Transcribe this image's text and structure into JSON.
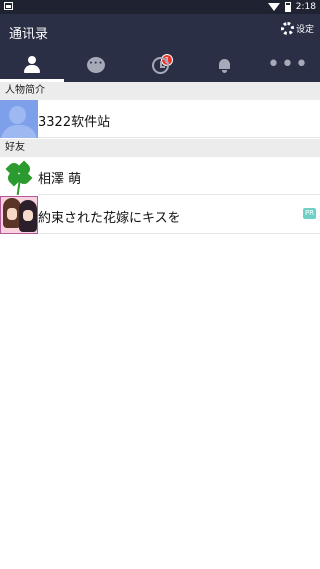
{
  "status_bar": {
    "time": "2:18"
  },
  "app_bar": {
    "title": "通讯录",
    "settings_label": "设定"
  },
  "tabs": [
    {
      "icon": "person-icon",
      "active": true
    },
    {
      "icon": "chat-icon",
      "badge": "1"
    },
    {
      "icon": "clock-icon"
    },
    {
      "icon": "bell-icon"
    },
    {
      "icon": "more-icon",
      "glyph": "•••"
    }
  ],
  "profile": {
    "section_title": "人物简介",
    "name": "3322软件站"
  },
  "friends": {
    "section_title": "好友",
    "items": [
      {
        "name": "相澤 萌",
        "avatar": "clover-avatar"
      },
      {
        "name": "約束された花嫁にキスを",
        "avatar": "anime-avatar",
        "tag": "PR"
      }
    ]
  },
  "colors": {
    "header": "#2a2f45",
    "status_bar": "#1f2230",
    "section": "#ececec",
    "badge": "#e8352f",
    "pr_tag": "#6fd1c6"
  }
}
